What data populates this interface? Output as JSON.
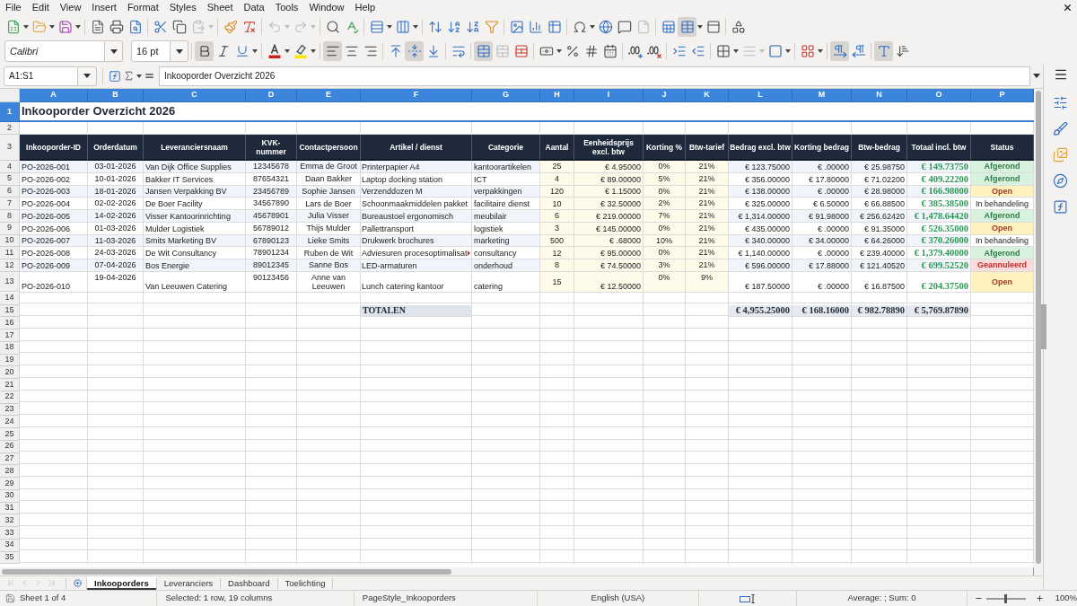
{
  "menu_bar": [
    "File",
    "Edit",
    "View",
    "Insert",
    "Format",
    "Styles",
    "Sheet",
    "Data",
    "Tools",
    "Window",
    "Help"
  ],
  "standard_toolbar": {
    "paste": {
      "disabled": true
    },
    "undo": {
      "disabled": true
    },
    "redo": {
      "disabled": true
    },
    "headers_footers": {
      "disabled": true
    },
    "freeze_rows_columns": {
      "pressed": true
    }
  },
  "formatting_toolbar": {
    "font_name": "Calibri",
    "font_size": "16 pt",
    "bold": {
      "pressed": true
    },
    "italic": {
      "pressed": false
    },
    "underline": {
      "pressed": false
    },
    "align_left": {
      "pressed": true
    },
    "align_center": {
      "pressed": false
    },
    "align_right": {
      "pressed": false
    },
    "align_top": {
      "pressed": false
    },
    "center_vertically": {
      "pressed": true
    },
    "align_bottom": {
      "pressed": false
    },
    "wrap_text": {
      "pressed": false
    },
    "merge_and_center": {
      "pressed": true
    },
    "merge_cells": {
      "disabled": true
    },
    "border_style": {
      "disabled": true
    },
    "left_to_right": {
      "pressed": true
    },
    "right_to_left": {
      "pressed": false
    },
    "text_horizontal": {
      "pressed": true
    },
    "text_vertical": {
      "pressed": false
    }
  },
  "formula_bar": {
    "name_box": "A1:S1",
    "content": "Inkooporder Overzicht 2026"
  },
  "sheet": {
    "columns": [
      {
        "label": "A",
        "selected": true
      },
      {
        "label": "B",
        "selected": true
      },
      {
        "label": "C",
        "selected": true
      },
      {
        "label": "D",
        "selected": true
      },
      {
        "label": "E",
        "selected": true
      },
      {
        "label": "F",
        "selected": true
      },
      {
        "label": "G",
        "selected": true
      },
      {
        "label": "H",
        "selected": true
      },
      {
        "label": "I",
        "selected": true
      },
      {
        "label": "J",
        "selected": true
      },
      {
        "label": "K",
        "selected": true
      },
      {
        "label": "L",
        "selected": true
      },
      {
        "label": "M",
        "selected": true
      },
      {
        "label": "N",
        "selected": true
      },
      {
        "label": "O",
        "selected": true
      },
      {
        "label": "P",
        "selected": true
      }
    ],
    "row_headers": [
      {
        "label": "1",
        "selected": true
      },
      {
        "label": "2",
        "selected": false
      },
      {
        "label": "3",
        "selected": false
      },
      {
        "label": "4",
        "selected": false
      },
      {
        "label": "5",
        "selected": false
      },
      {
        "label": "6",
        "selected": false
      },
      {
        "label": "7",
        "selected": false
      },
      {
        "label": "8",
        "selected": false
      },
      {
        "label": "9",
        "selected": false
      },
      {
        "label": "10",
        "selected": false
      },
      {
        "label": "11",
        "selected": false
      },
      {
        "label": "12",
        "selected": false
      },
      {
        "label": "13",
        "selected": false
      },
      {
        "label": "14",
        "selected": false
      },
      {
        "label": "15",
        "selected": false
      },
      {
        "label": "16",
        "selected": false
      },
      {
        "label": "17",
        "selected": false
      },
      {
        "label": "18",
        "selected": false
      },
      {
        "label": "19",
        "selected": false
      },
      {
        "label": "20",
        "selected": false
      },
      {
        "label": "21",
        "selected": false
      },
      {
        "label": "22",
        "selected": false
      },
      {
        "label": "23",
        "selected": false
      },
      {
        "label": "24",
        "selected": false
      },
      {
        "label": "25",
        "selected": false
      },
      {
        "label": "26",
        "selected": false
      },
      {
        "label": "27",
        "selected": false
      },
      {
        "label": "28",
        "selected": false
      },
      {
        "label": "29",
        "selected": false
      },
      {
        "label": "30",
        "selected": false
      },
      {
        "label": "31",
        "selected": false
      },
      {
        "label": "32",
        "selected": false
      },
      {
        "label": "33",
        "selected": false
      },
      {
        "label": "34",
        "selected": false
      },
      {
        "label": "35",
        "selected": false
      }
    ],
    "title": "Inkooporder Overzicht 2026",
    "headers": [
      "Inkooporder-ID",
      "Orderdatum",
      "Leveranciersnaam",
      "KVK-nummer",
      "Contactpersoon",
      "Artikel / dienst",
      "Categorie",
      "Aantal",
      "Eenheidsprijs excl. btw",
      "Korting %",
      "Btw-tarief",
      "Bedrag excl. btw",
      "Korting bedrag",
      "Btw-bedrag",
      "Totaal incl. btw",
      "Status"
    ],
    "rows": [
      {
        "cells": [
          "PO-2026-001",
          "03-01-2026",
          "Van Dijk Office Supplies",
          "12345678",
          "Emma de Groot",
          "Printerpapier A4",
          "kantoorartikelen",
          "25",
          "€ 4.95000",
          "0%",
          "21%",
          "€ 123.75000",
          "€ .00000",
          "€ 25.98750",
          "€ 149.73750"
        ],
        "clipped": false,
        "status": {
          "label": "Afgerond",
          "kind": "done"
        }
      },
      {
        "cells": [
          "PO-2026-002",
          "10-01-2026",
          "Bakker IT Services",
          "87654321",
          "Daan Bakker",
          "Laptop docking station",
          "ICT",
          "4",
          "€ 89.00000",
          "5%",
          "21%",
          "€ 356.00000",
          "€ 17.80000",
          "€ 71.02200",
          "€ 409.22200"
        ],
        "clipped": false,
        "status": {
          "label": "Afgerond",
          "kind": "done"
        }
      },
      {
        "cells": [
          "PO-2026-003",
          "18-01-2026",
          "Jansen Verpakking BV",
          "23456789",
          "Sophie Jansen",
          "Verzenddozen M",
          "verpakkingen",
          "120",
          "€ 1.15000",
          "0%",
          "21%",
          "€ 138.00000",
          "€ .00000",
          "€ 28.98000",
          "€ 166.98000"
        ],
        "clipped": false,
        "status": {
          "label": "Open",
          "kind": "open"
        }
      },
      {
        "cells": [
          "PO-2026-004",
          "02-02-2026",
          "De Boer Facility",
          "34567890",
          "Lars de Boer",
          "Schoonmaakmiddelen pakket",
          "facilitaire dienst",
          "10",
          "€ 32.50000",
          "2%",
          "21%",
          "€ 325.00000",
          "€ 6.50000",
          "€ 66.88500",
          "€ 385.38500"
        ],
        "clipped": false,
        "status": {
          "label": "In behandeling",
          "kind": "progress"
        }
      },
      {
        "cells": [
          "PO-2026-005",
          "14-02-2026",
          "Visser Kantoorinrichting",
          "45678901",
          "Julia Visser",
          "Bureaustoel ergonomisch",
          "meubilair",
          "6",
          "€ 219.00000",
          "7%",
          "21%",
          "€ 1,314.00000",
          "€ 91.98000",
          "€ 256.62420",
          "€ 1,478.64420"
        ],
        "clipped": false,
        "status": {
          "label": "Afgerond",
          "kind": "done"
        }
      },
      {
        "cells": [
          "PO-2026-006",
          "01-03-2026",
          "Mulder Logistiek",
          "56789012",
          "Thijs Mulder",
          "Pallettransport",
          "logistiek",
          "3",
          "€ 145.00000",
          "0%",
          "21%",
          "€ 435.00000",
          "€ .00000",
          "€ 91.35000",
          "€ 526.35000"
        ],
        "clipped": false,
        "status": {
          "label": "Open",
          "kind": "open"
        }
      },
      {
        "cells": [
          "PO-2026-007",
          "11-03-2026",
          "Smits Marketing BV",
          "67890123",
          "Lieke Smits",
          "Drukwerk brochures",
          "marketing",
          "500",
          "€ .68000",
          "10%",
          "21%",
          "€ 340.00000",
          "€ 34.00000",
          "€ 64.26000",
          "€ 370.26000"
        ],
        "clipped": false,
        "status": {
          "label": "In behandeling",
          "kind": "progress"
        }
      },
      {
        "cells": [
          "PO-2026-008",
          "24-03-2026",
          "De Wit Consultancy",
          "78901234",
          "Ruben de Wit",
          "Adviesuren procesoptimalisat",
          "consultancy",
          "12",
          "€ 95.00000",
          "0%",
          "21%",
          "€ 1,140.00000",
          "€ .00000",
          "€ 239.40000",
          "€ 1,379.40000"
        ],
        "clipped": true,
        "status": {
          "label": "Afgerond",
          "kind": "done"
        }
      },
      {
        "cells": [
          "PO-2026-009",
          "07-04-2026",
          "Bos Energie",
          "89012345",
          "Sanne Bos",
          "LED-armaturen",
          "onderhoud",
          "8",
          "€ 74.50000",
          "3%",
          "21%",
          "€ 596.00000",
          "€ 17.88000",
          "€ 121.40520",
          "€ 699.52520"
        ],
        "clipped": false,
        "status": {
          "label": "Geannuleerd",
          "kind": "cancelled"
        }
      },
      {
        "cells": [
          "PO-2026-010",
          "19-04-2026",
          "Van Leeuwen Catering",
          "90123456",
          "Anne van Leeuwen",
          "Lunch catering kantoor",
          "catering",
          "15",
          "€ 12.50000",
          "0%",
          "9%",
          "€ 187.50000",
          "€ .00000",
          "€ 16.87500",
          "€ 204.37500"
        ],
        "clipped": false,
        "status": {
          "label": "Open",
          "kind": "open"
        }
      }
    ],
    "totals": {
      "label": "TOTALEN",
      "values": [
        "€ 4,955.25000",
        "€ 168.16000",
        "€ 982.78890",
        "€ 5,769.87890"
      ]
    }
  },
  "tab_navigation": {
    "disabled": true
  },
  "sheet_tabs": [
    {
      "label": "Inkooporders",
      "selected": true
    },
    {
      "label": "Leveranciers",
      "selected": false
    },
    {
      "label": "Dashboard",
      "selected": false
    },
    {
      "label": "Toelichting",
      "selected": false
    }
  ],
  "status_bar": {
    "sheet": "Sheet 1 of 4",
    "selection": "Selected: 1 row, 19 columns",
    "page_style": "PageStyle_Inkooporders",
    "language": "English (USA)",
    "summary": "Average: ; Sum: 0",
    "zoom": {
      "level": 0.5,
      "label": "100%"
    }
  }
}
